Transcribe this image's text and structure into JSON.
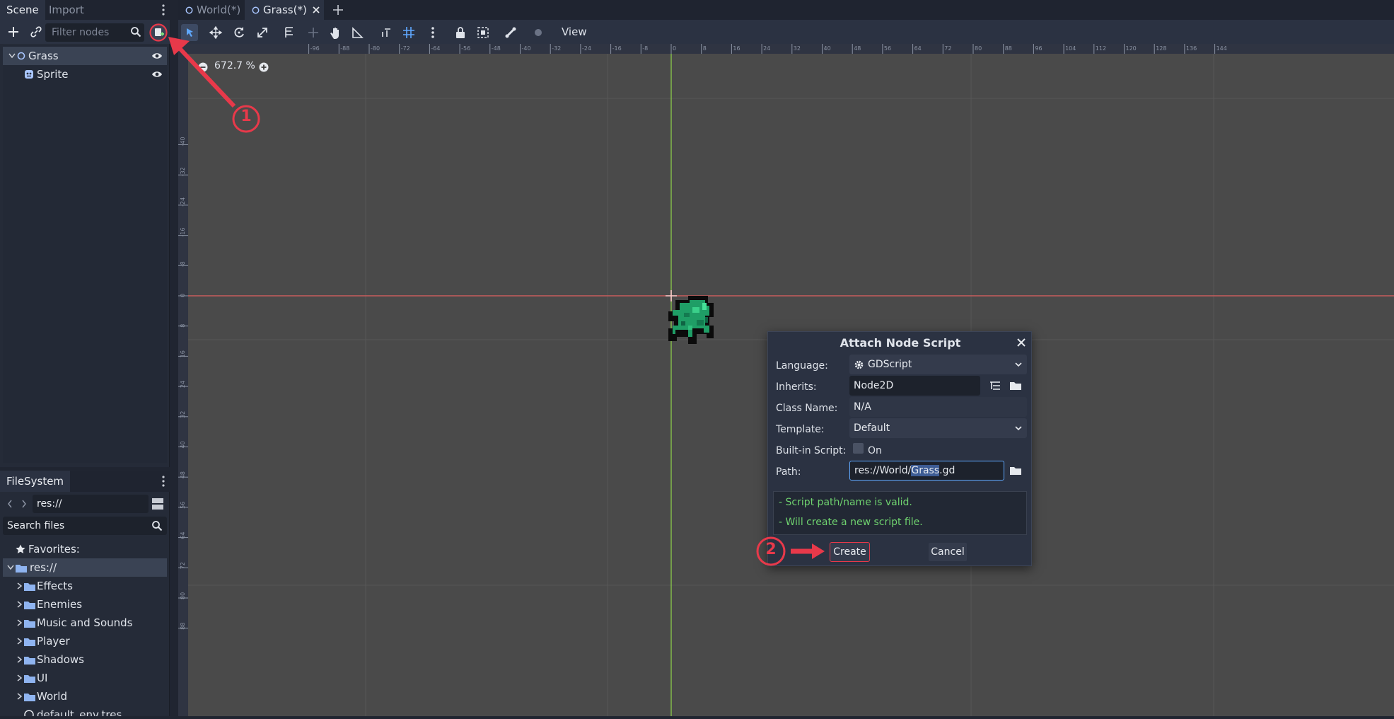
{
  "scene_dock": {
    "tabs": [
      "Scene",
      "Import"
    ],
    "filter_placeholder": "Filter nodes",
    "tree": [
      {
        "label": "Grass",
        "selected": true
      },
      {
        "label": "Sprite",
        "selected": false
      }
    ]
  },
  "filesystem": {
    "tab": "FileSystem",
    "path": "res://",
    "search_placeholder": "Search files",
    "favorites": "Favorites:",
    "root": "res://",
    "folders": [
      "Effects",
      "Enemies",
      "Music and Sounds",
      "Player",
      "Shadows",
      "UI",
      "World"
    ],
    "file": "default_env.tres"
  },
  "editor_tabs": [
    "World(*)",
    "Grass(*)"
  ],
  "toolbar": {
    "view_label": "View"
  },
  "viewport": {
    "zoom": "672.7 %",
    "ruler_top": [
      "-96",
      "-88",
      "-80",
      "-72",
      "-64",
      "-56",
      "-48",
      "-40",
      "-32",
      "-24",
      "-16",
      "-8",
      "0",
      "8",
      "16",
      "24",
      "32",
      "40",
      "48",
      "56",
      "64",
      "72",
      "80",
      "88",
      "96",
      "104",
      "112",
      "120",
      "128",
      "136",
      "144"
    ],
    "ruler_left": [
      "-40",
      "-32",
      "-24",
      "-16",
      "-8",
      "0",
      "8",
      "16",
      "24",
      "32",
      "40",
      "48",
      "56",
      "64",
      "72",
      "80",
      "88"
    ]
  },
  "annotations": {
    "step1": "1",
    "step2": "2"
  },
  "dialog": {
    "title": "Attach Node Script",
    "language_label": "Language:",
    "language_value": "GDScript",
    "inherits_label": "Inherits:",
    "inherits_value": "Node2D",
    "class_label": "Class Name:",
    "class_placeholder": "N/A",
    "template_label": "Template:",
    "template_value": "Default",
    "builtin_label": "Built-in Script:",
    "builtin_option": "On",
    "path_label": "Path:",
    "path_prefix": "res://World/",
    "path_selected": "Grass",
    "path_suffix": ".gd",
    "msg1": "- Script path/name is valid.",
    "msg2": "- Will create a new script file.",
    "create": "Create",
    "cancel": "Cancel"
  },
  "colors": {
    "accent": "#5fa8ff",
    "annotation": "#e8394a",
    "valid": "#6fd26f"
  }
}
